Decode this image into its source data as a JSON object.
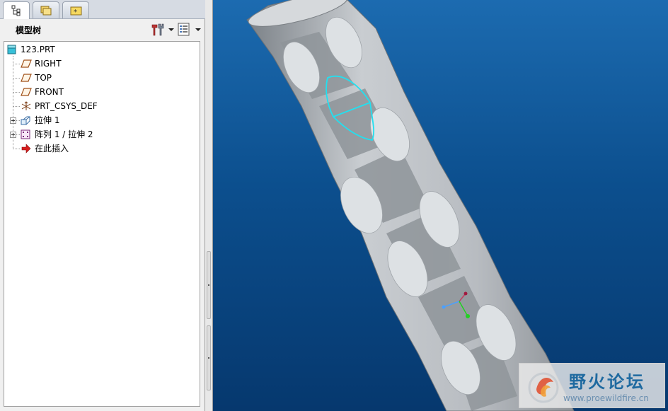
{
  "tabs": [
    {
      "icon": "model-tree-icon",
      "active": true
    },
    {
      "icon": "folder-browser-icon",
      "active": false
    },
    {
      "icon": "favorites-icon",
      "active": false
    }
  ],
  "toolbar": {
    "title": "模型树",
    "settings_icon": "tools-icon",
    "show_icon": "tree-columns-icon"
  },
  "tree": {
    "root": {
      "label": "123.PRT",
      "icon": "part-icon"
    },
    "items": [
      {
        "label": "RIGHT",
        "icon": "datum-plane-icon",
        "expandable": false
      },
      {
        "label": "TOP",
        "icon": "datum-plane-icon",
        "expandable": false
      },
      {
        "label": "FRONT",
        "icon": "datum-plane-icon",
        "expandable": false
      },
      {
        "label": "PRT_CSYS_DEF",
        "icon": "coordinate-system-icon",
        "expandable": false
      },
      {
        "label": "拉伸 1",
        "icon": "extrude-icon",
        "expandable": true
      },
      {
        "label": "阵列 1 / 拉伸 2",
        "icon": "pattern-icon",
        "expandable": true
      },
      {
        "label": "在此插入",
        "icon": "insert-here-arrow-icon",
        "expandable": false
      }
    ]
  },
  "viewport": {
    "background_top": "#1c6bb0",
    "background_bottom": "#06386e",
    "model_color": "#c4c8cc",
    "selection_color": "#22e0f0"
  },
  "watermark": {
    "title": "野火论坛",
    "url": "www.proewildfire.cn"
  }
}
